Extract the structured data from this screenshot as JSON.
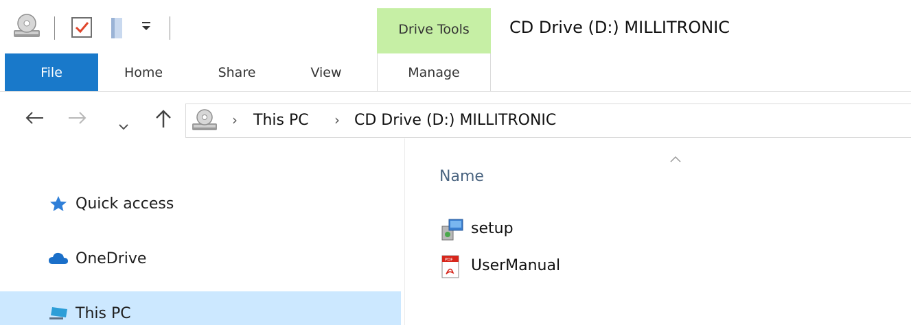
{
  "window": {
    "title": "CD Drive (D:) MILLITRONIC",
    "contextual_tab_group": "Drive Tools"
  },
  "quick_access_toolbar": {
    "icons": [
      "cd-drive-icon",
      "properties-checkbox-icon",
      "new-folder-icon",
      "customize-dropdown-icon"
    ]
  },
  "ribbon": {
    "tabs": [
      {
        "label": "File",
        "active": true
      },
      {
        "label": "Home"
      },
      {
        "label": "Share"
      },
      {
        "label": "View"
      },
      {
        "label": "Manage"
      }
    ]
  },
  "address_bar": {
    "breadcrumbs": [
      "This PC",
      "CD Drive (D:) MILLITRONIC"
    ]
  },
  "nav_pane": {
    "items": [
      {
        "label": "Quick access",
        "icon": "star-icon"
      },
      {
        "label": "OneDrive",
        "icon": "cloud-icon"
      },
      {
        "label": "This PC",
        "icon": "computer-icon",
        "selected": true
      }
    ]
  },
  "file_list": {
    "column_header": "Name",
    "files": [
      {
        "name": "setup",
        "icon": "installer-icon"
      },
      {
        "name": "UserManual",
        "icon": "pdf-icon"
      }
    ]
  },
  "colors": {
    "file_tab": "#1979ca",
    "drive_tools": "#c6efa5",
    "selection": "#cce8ff",
    "header_text": "#4a6480"
  }
}
